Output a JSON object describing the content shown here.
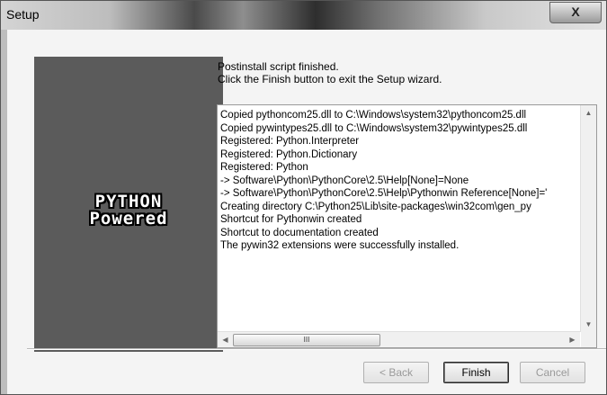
{
  "window": {
    "title": "Setup",
    "close_label": "X"
  },
  "banner": {
    "logo_line1": "PYTHON",
    "logo_line2": "Powered"
  },
  "message": {
    "line1": "Postinstall script finished.",
    "line2": "Click the Finish button to exit the Setup wizard."
  },
  "log": {
    "lines": [
      "Copied pythoncom25.dll to C:\\Windows\\system32\\pythoncom25.dll",
      "Copied pywintypes25.dll to C:\\Windows\\system32\\pywintypes25.dll",
      "Registered: Python.Interpreter",
      "Registered: Python.Dictionary",
      "Registered: Python",
      "-> Software\\Python\\PythonCore\\2.5\\Help[None]=None",
      "-> Software\\Python\\PythonCore\\2.5\\Help\\Pythonwin Reference[None]='",
      "Creating directory C:\\Python25\\Lib\\site-packages\\win32com\\gen_py",
      "Shortcut for Pythonwin created",
      "Shortcut to documentation created",
      "The pywin32 extensions were successfully installed."
    ],
    "hscroll_grip": "III"
  },
  "buttons": {
    "back": "< Back",
    "finish": "Finish",
    "cancel": "Cancel"
  }
}
